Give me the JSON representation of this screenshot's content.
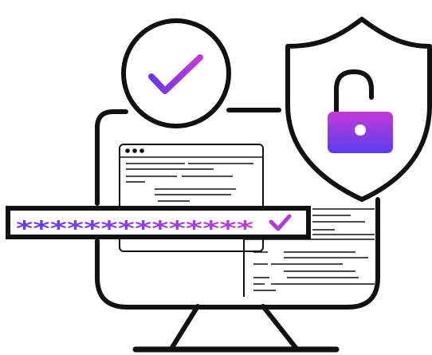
{
  "illustration": {
    "password_field": {
      "masked_value": "**************"
    },
    "icons": {
      "verified": "checkmark-circle-icon",
      "security": "shield-unlocked-padlock-icon",
      "device": "desktop-monitor-icon",
      "field_status": "checkmark-icon"
    },
    "colors": {
      "outline": "#111111",
      "gradient_start": "#5a3df0",
      "gradient_end": "#c43ad8",
      "background": "#ffffff"
    }
  }
}
